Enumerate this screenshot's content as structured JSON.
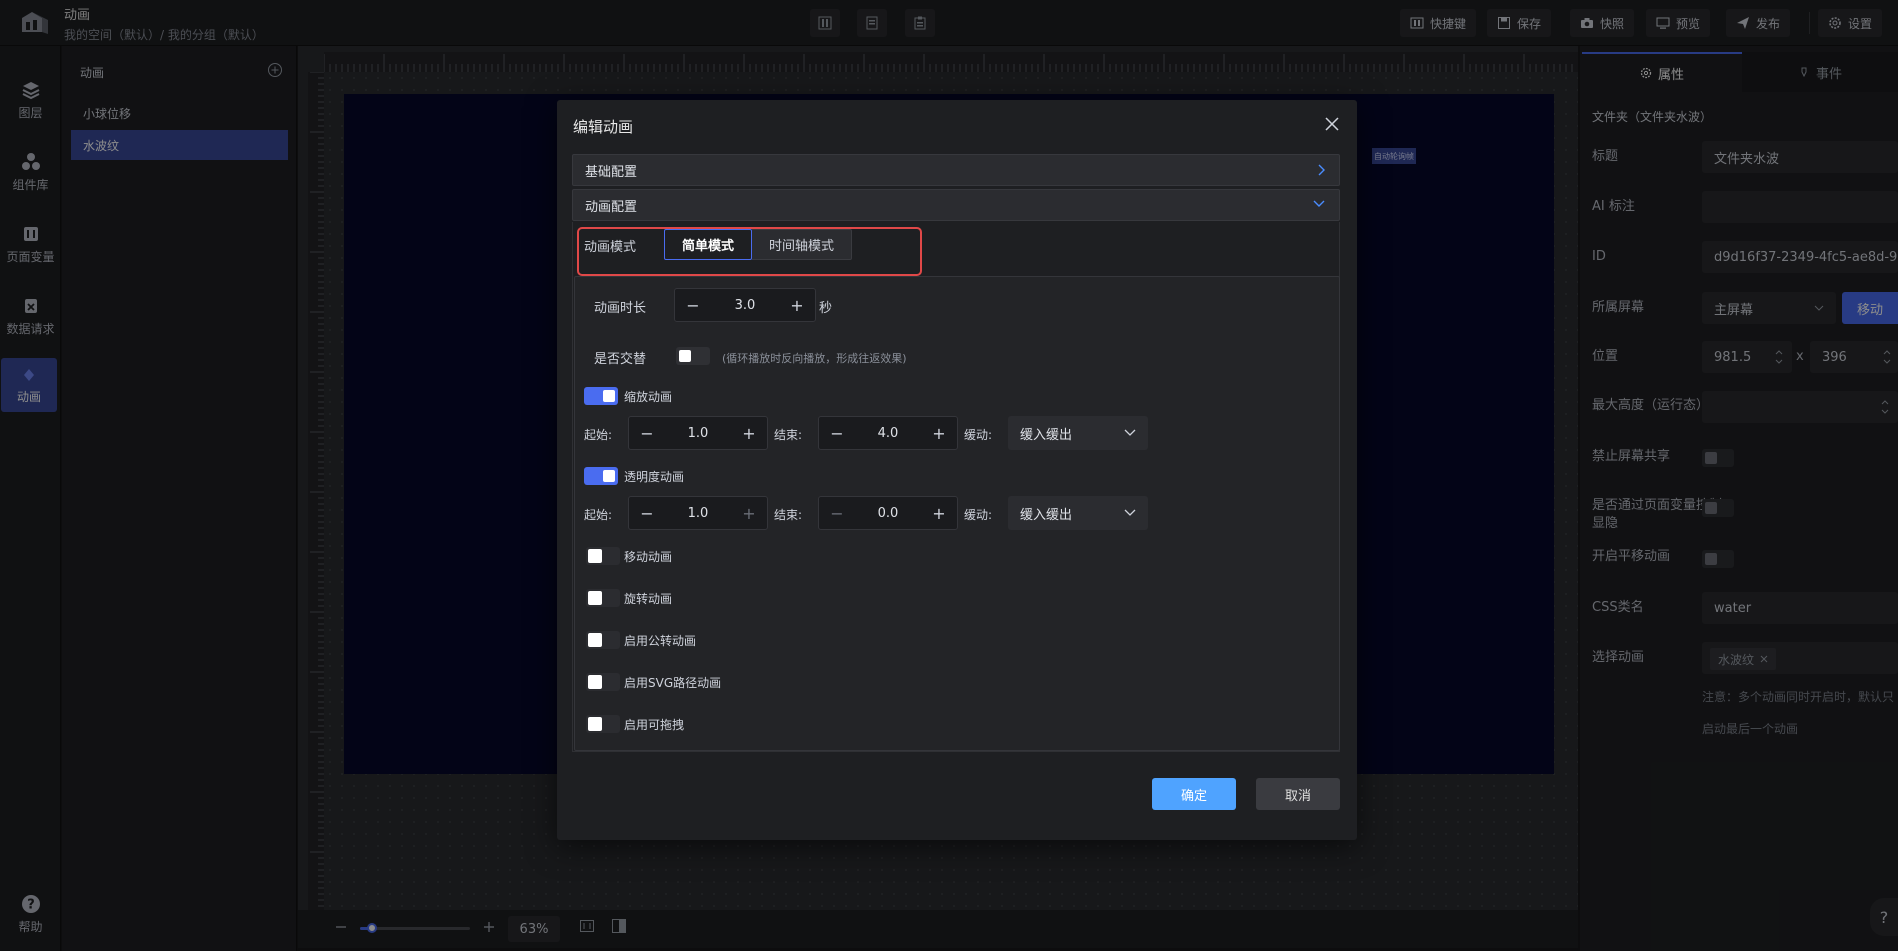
{
  "header": {
    "title": "动画",
    "path": "我的空间（默认）/ 我的分组（默认）",
    "buttons": [
      "快捷键",
      "保存",
      "快照",
      "预览",
      "发布",
      "设置"
    ]
  },
  "rail": {
    "items": [
      "图层",
      "组件库",
      "页面变量",
      "数据请求",
      "动画"
    ],
    "help": "帮助"
  },
  "anim_panel": {
    "title": "动画",
    "items": [
      "小球位移",
      "水波纹"
    ]
  },
  "canvas": {
    "badge": "自动轮询帧",
    "zoom": "63%"
  },
  "right_panel": {
    "tabs": [
      "属性",
      "事件"
    ],
    "folder_label": "文件夹（文件夹水波）",
    "fields": {
      "title_label": "标题",
      "title_value": "文件夹水波",
      "ai_label": "AI 标注",
      "id_label": "ID",
      "id_value": "d9d16f37-2349-4fc5-ae8d-9",
      "screen_label": "所属屏幕",
      "screen_value": "主屏幕",
      "move_label": "移动",
      "pos_label": "位置",
      "pos_x": "981.5",
      "pos_sep": "x",
      "pos_y": "396",
      "maxh_label": "最大高度（运行态）",
      "share_label": "禁止屏幕共享",
      "var_label": "是否通过页面变量控制显隐",
      "pan_label": "开启平移动画",
      "css_label": "CSS类名",
      "css_value": "water",
      "choose_label": "选择动画",
      "choose_tag": "水波纹",
      "note1": "注意：多个动画同时开启时，默认只",
      "note2": "启动最后一个动画"
    }
  },
  "modal": {
    "title": "编辑动画",
    "section_basic": "基础配置",
    "section_anim": "动画配置",
    "mode_label": "动画模式",
    "mode_simple": "简单模式",
    "mode_timeline": "时间轴模式",
    "duration_label": "动画时长",
    "duration_value": "3.0",
    "duration_unit": "秒",
    "alternate_label": "是否交替",
    "alternate_hint": "(循环播放时反向播放，形成往返效果)",
    "scale_label": "缩放动画",
    "scale_start_label": "起始:",
    "scale_start": "1.0",
    "scale_end_label": "结束:",
    "scale_end": "4.0",
    "scale_ease_label": "缓动:",
    "scale_ease": "缓入缓出",
    "opacity_label": "透明度动画",
    "opacity_start_label": "起始:",
    "opacity_start": "1.0",
    "opacity_end_label": "结束:",
    "opacity_end": "0.0",
    "opacity_ease_label": "缓动:",
    "opacity_ease": "缓入缓出",
    "checks": [
      "移动动画",
      "旋转动画",
      "启用公转动画",
      "启用SVG路径动画",
      "启用可拖拽"
    ],
    "ok": "确定",
    "cancel": "取消"
  },
  "colors": {
    "accent": "#4a6cf0",
    "ok_button": "#4fa3ff",
    "artboard": "#06082a",
    "highlight": "#e04848"
  }
}
